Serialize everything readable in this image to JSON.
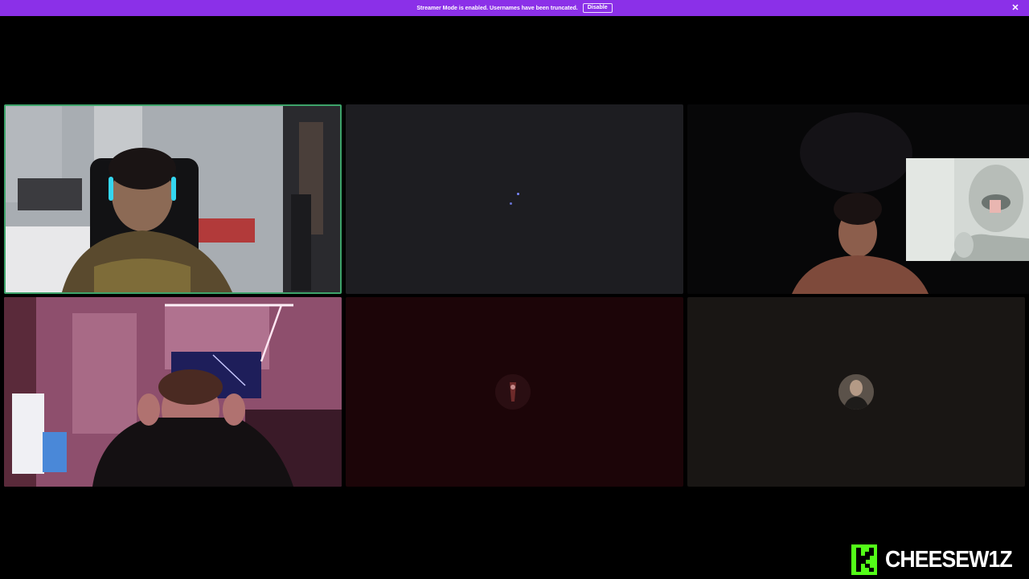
{
  "banner": {
    "message": "Streamer Mode is enabled. Usernames have been truncated.",
    "disable_label": "Disable",
    "close_icon": "close-icon",
    "color": "#8b30e8"
  },
  "tiles": [
    {
      "name": "participant-video-1",
      "state": "video",
      "speaking": true,
      "highlight_color": "#3ea46b"
    },
    {
      "name": "participant-video-2",
      "state": "loading"
    },
    {
      "name": "participant-video-3",
      "state": "video"
    },
    {
      "name": "participant-video-4",
      "state": "video"
    },
    {
      "name": "participant-video-5",
      "state": "avatar"
    },
    {
      "name": "participant-video-6",
      "state": "avatar"
    }
  ],
  "watermark": {
    "text": "CHEESEW1Z",
    "brand_color": "#53fc18",
    "icon": "kick-logo-icon"
  }
}
